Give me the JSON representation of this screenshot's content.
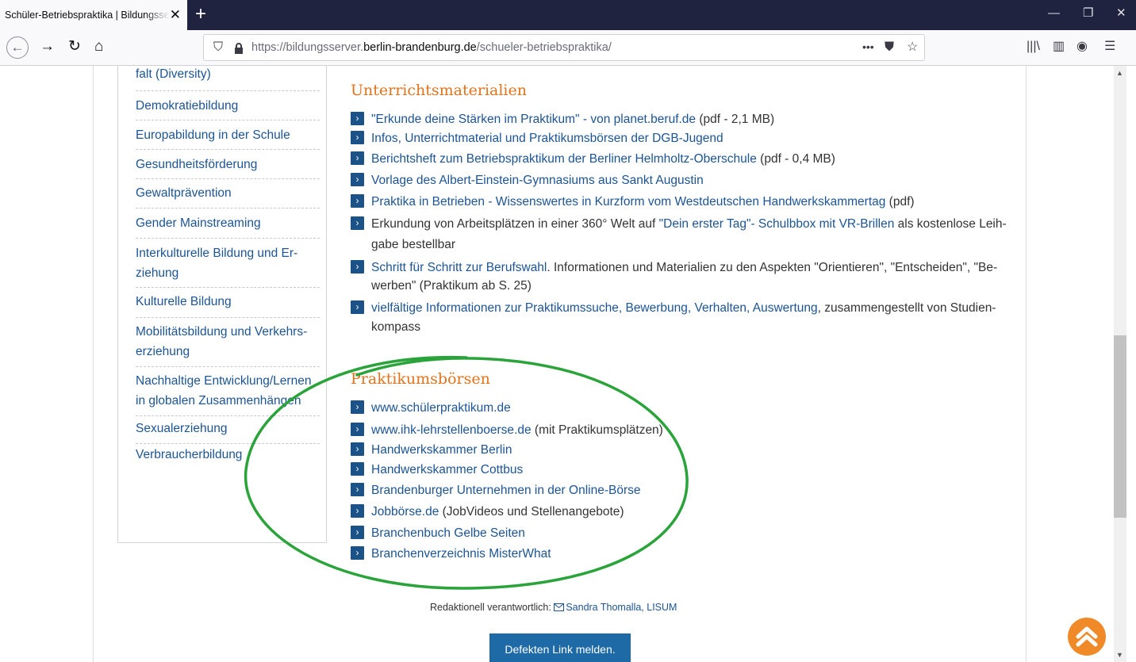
{
  "browser": {
    "tab_title": "Schüler-Betriebspraktika | Bildungsserver Berlin-Brandenburg",
    "tab_close": "✕",
    "new_tab": "+",
    "url_prefix": "https://bildungsserver.",
    "url_domain": "berlin-brandenburg.de",
    "url_path": "/schueler-betriebspraktika/",
    "page_actions": "•••"
  },
  "sidebar": {
    "items": [
      "falt (Diversity)",
      "Demokratiebildung",
      "Europabildung in der Schule",
      "Gesundheitsförderung",
      "Gewaltprävention",
      "Gender Mainstreaming",
      "Interkulturelle Bildung und Er-",
      "ziehung",
      "Kulturelle Bildung",
      "Mobilitätsbildung und Verkehrs-",
      "erziehung",
      "Nachhaltige Entwicklung/Lernen",
      "in globalen Zusammenhängen",
      "Sexualerziehung",
      "Verbraucherbildung"
    ]
  },
  "materials": {
    "title": "Unterrichtsmaterialien",
    "items": [
      {
        "link": "\"Erkunde deine Stärken im Praktikum\" - von planet.beruf.de",
        "text": " (pdf - 2,1 MB)"
      },
      {
        "link": "Infos, Unterrichtmaterial und Praktikumsbörsen der DGB-Jugend",
        "text": ""
      },
      {
        "link": "Berichtsheft zum Betriebspraktikum der Berliner Helmholtz-Oberschule",
        "text": " (pdf - 0,4 MB)"
      },
      {
        "link": "Vorlage des Albert-Einstein-Gymnasiums aus Sankt Augustin",
        "text": ""
      },
      {
        "link": "Praktika in Betrieben - Wissenswertes in Kurzform vom Westdeutschen Handwerkskammertag",
        "text": " (pdf)"
      }
    ],
    "item6_pre": "Erkundung von Arbeitsplätzen in einer 360° Welt auf ",
    "item6_link": "\"Dein erster Tag\"- Schulbbox mit VR-Brillen",
    "item6_post": " als kostenlose Leih-",
    "item6_cont": "gabe bestellbar",
    "item7_link": "Schritt für Schritt zur Berufswahl",
    "item7_post": ". Informationen und Materialien zu den Aspekten \"Orientieren\", \"Entscheiden\", \"Be-",
    "item7_cont": "werben\" (Praktikum ab S. 25)",
    "item8_link": "vielfältige Informationen zur Praktikumssuche, Bewerbung, Verhalten, Auswertung",
    "item8_post": ", zusammengestellt von Studien-",
    "item8_cont": "kompass"
  },
  "boersen": {
    "title": "Praktikumsbörsen",
    "items": [
      {
        "link": "www.schülerpraktikum.de",
        "text": ""
      },
      {
        "link": "www.ihk-lehrstellenboerse.de",
        "text": " (mit Praktikumsplätzen)"
      },
      {
        "link": "Handwerkskammer Berlin",
        "text": ""
      },
      {
        "link": "Handwerkskammer Cottbus",
        "text": ""
      },
      {
        "link": "Brandenburger Unternehmen in der Online-Börse",
        "text": ""
      },
      {
        "link": "Jobbörse.de",
        "text": " (JobVideos und Stellenangebote)"
      },
      {
        "link": "Branchenbuch Gelbe Seiten",
        "text": ""
      },
      {
        "link": "Branchenverzeichnis MisterWhat",
        "text": ""
      }
    ]
  },
  "footer": {
    "credit_label": "Redaktionell verantwortlich: ",
    "credit_name": "Sandra Thomalla, LISUM",
    "report_button": "Defekten Link melden."
  },
  "colors": {
    "link": "#1c5494",
    "heading": "#e0731d",
    "annotation_oval": "#2aa43a",
    "button": "#1d6aa7",
    "scrolltop": "#f08a29"
  },
  "icons": [
    "back-icon",
    "forward-icon",
    "reload-icon",
    "home-icon",
    "shield-icon",
    "lock-icon",
    "bookmark-star-icon",
    "pocket-icon",
    "library-icon",
    "sidebar-icon",
    "account-icon",
    "menu-icon",
    "mail-icon",
    "chevron-up-icon"
  ]
}
